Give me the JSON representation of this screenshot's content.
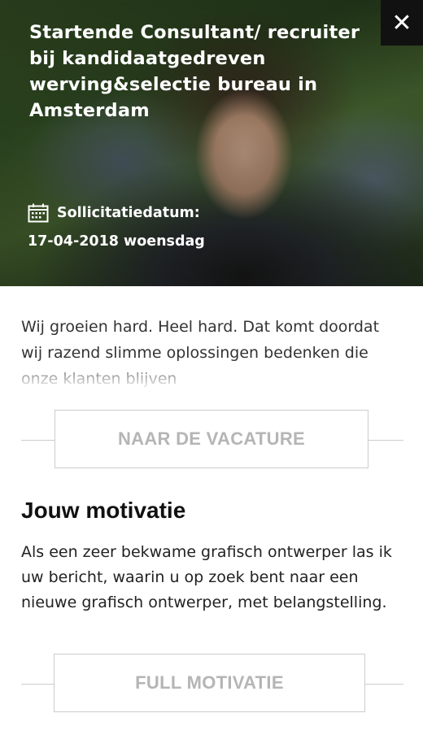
{
  "header": {
    "title": "Startende Consultant/ recruiter bij kandidaatgedreven werving&selectie bureau in Amsterdam",
    "title_lines": [
      "Startende Consultant/ recruiter",
      "bij kandidaatgedreven",
      "werving&selectie bureau in",
      "Amsterdam"
    ],
    "close_icon": "close-icon",
    "date_icon": "calendar-icon",
    "date_label": "Sollicitatiedatum:",
    "date_value": "17-04-2018 woensdag",
    "hero_image": "young man lying on grass with hands behind head"
  },
  "vacancy": {
    "intro_text": "Wij groeien hard. Heel hard. Dat komt doordat wij razend slimme oplossingen bedenken die onze klanten blijven",
    "button_label": "NAAR DE VACATURE"
  },
  "motivation": {
    "heading": "Jouw motivatie",
    "text": "Als een zeer bekwame grafisch ontwerper las ik uw bericht, waarin u op zoek bent naar een nieuwe grafisch ontwerper, met belangstelling.",
    "button_label": "FULL MOTIVATIE"
  },
  "colors": {
    "close_bg": "#111111",
    "button_text": "#b5b5b5",
    "border": "#cccccc",
    "heading": "#111111",
    "body_text": "#222222"
  }
}
